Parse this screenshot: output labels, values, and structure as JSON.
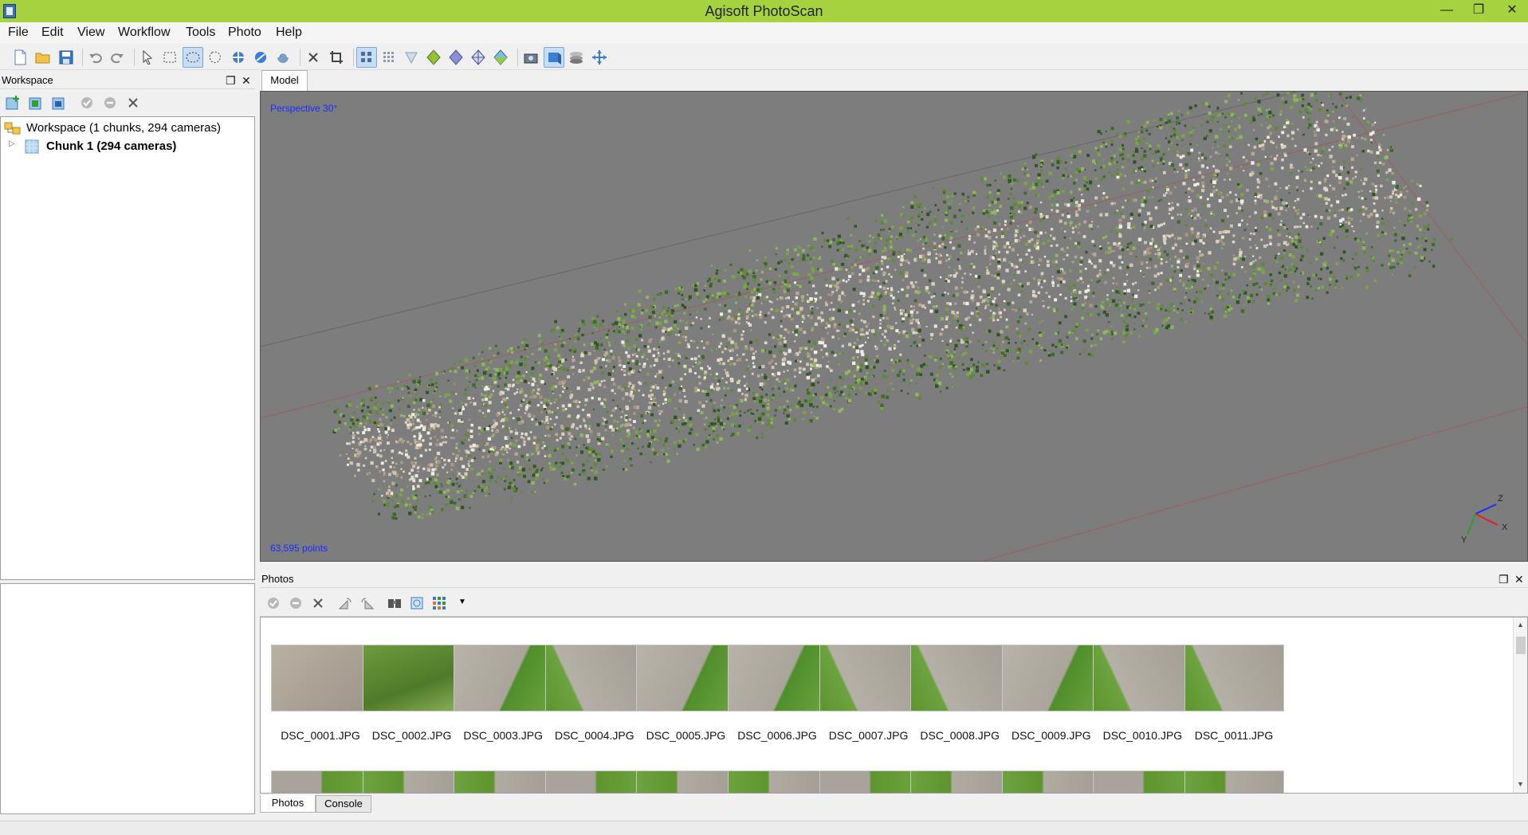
{
  "window": {
    "title": "Agisoft PhotoScan",
    "controls": [
      "—",
      "❐",
      "✕"
    ]
  },
  "menu": [
    "File",
    "Edit",
    "View",
    "Workflow",
    "Tools",
    "Photo",
    "Help"
  ],
  "toolbar": {
    "icons": [
      "new-project",
      "open-project",
      "save-project",
      "undo",
      "redo",
      "navigation",
      "rectangle-selection",
      "circle-selection",
      "free-form-selection",
      "resize-region",
      "move-region",
      "rotate-region",
      "delete-selection",
      "crop-selection",
      "point-cloud",
      "dense-cloud",
      "shaded",
      "solid",
      "wireframe",
      "textured",
      "show-cameras",
      "show-region",
      "show-aligned-chunks",
      "reset-view"
    ],
    "active": [
      "circle-selection",
      "point-cloud",
      "show-region"
    ]
  },
  "workspace": {
    "title": "Workspace",
    "root_label": "Workspace (1 chunks, 294 cameras)",
    "chunk_label": "Chunk 1 (294 cameras)"
  },
  "model": {
    "tab": "Model",
    "perspective": "Perspective 30°",
    "points": "63,595 points",
    "axes": {
      "x": "X",
      "y": "Y",
      "z": "Z"
    }
  },
  "photos": {
    "title": "Photos",
    "items": [
      "DSC_0001.JPG",
      "DSC_0002.JPG",
      "DSC_0003.JPG",
      "DSC_0004.JPG",
      "DSC_0005.JPG",
      "DSC_0006.JPG",
      "DSC_0007.JPG",
      "DSC_0008.JPG",
      "DSC_0009.JPG",
      "DSC_0010.JPG",
      "DSC_0011.JPG"
    ]
  },
  "bottom_tabs": [
    "Photos",
    "Console"
  ],
  "colors": {
    "titlebar": "#a6d23f",
    "viewport_bg": "#7d7d7d",
    "label_blue": "#1a2cff"
  }
}
